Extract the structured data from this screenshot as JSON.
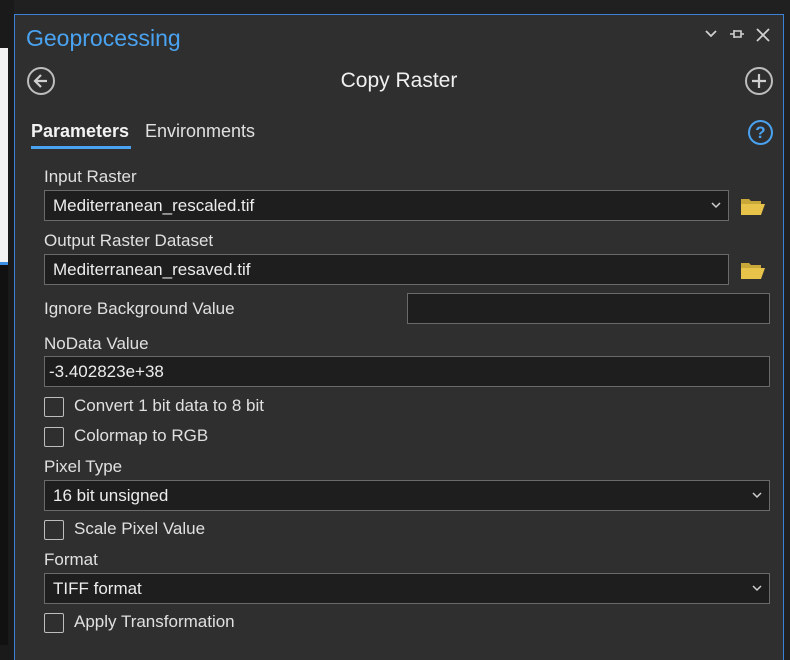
{
  "panel": {
    "title": "Geoprocessing",
    "tool_title": "Copy Raster"
  },
  "tabs": {
    "parameters": "Parameters",
    "environments": "Environments"
  },
  "help": {
    "glyph": "?"
  },
  "params": {
    "input_raster": {
      "label": "Input Raster",
      "value": "Mediterranean_rescaled.tif"
    },
    "output_raster": {
      "label": "Output Raster Dataset",
      "value": "Mediterranean_resaved.tif"
    },
    "ignore_bg": {
      "label": "Ignore Background Value",
      "value": ""
    },
    "nodata": {
      "label": "NoData Value",
      "value": "-3.402823e+38"
    },
    "convert_1bit": {
      "label": "Convert 1 bit data to 8 bit",
      "checked": false
    },
    "colormap_rgb": {
      "label": "Colormap to RGB",
      "checked": false
    },
    "pixel_type": {
      "label": "Pixel Type",
      "value": "16 bit unsigned"
    },
    "scale_pixel": {
      "label": "Scale Pixel Value",
      "checked": false
    },
    "format": {
      "label": "Format",
      "value": "TIFF format"
    },
    "apply_transform": {
      "label": "Apply Transformation",
      "checked": false
    }
  },
  "colors": {
    "accent": "#4aa3f0",
    "panel_bg": "#2f2f2f",
    "field_bg": "#1e1e1e",
    "folder": "#e8c34a"
  }
}
